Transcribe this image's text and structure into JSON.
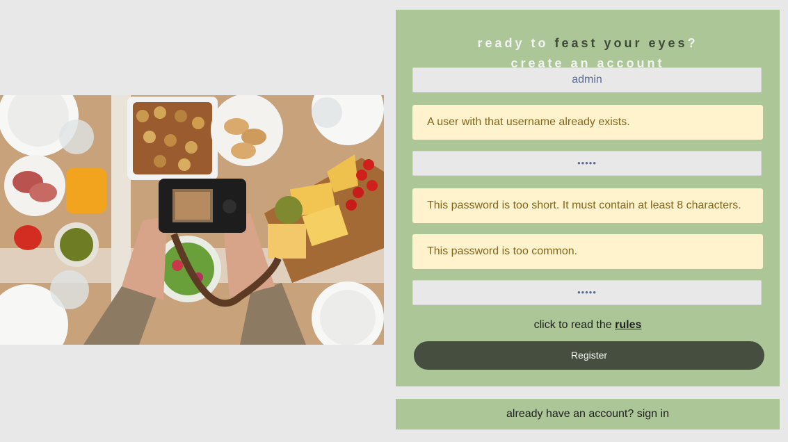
{
  "form": {
    "title_line1_a": "ready to",
    "title_line1_b": "feast your eyes",
    "title_line1_c": "?",
    "title_line2": "create an account",
    "username_value": "admin",
    "username_error": "A user with that username already exists.",
    "password_value": "•••••",
    "password_error_1": "This password is too short. It must contain at least 8 characters.",
    "password_error_2": "This password is too common.",
    "confirm_value": "•••••",
    "rules_prefix": "click to read the",
    "rules_link": "rules",
    "register_label": "Register"
  },
  "footer": {
    "signin_text": "already have an account? sign in"
  },
  "colors": {
    "background": "#e8e8e8",
    "card": "#adc698",
    "button": "#464f3f",
    "alert_bg": "#fff3cd",
    "alert_text": "#85651a"
  },
  "hero": {
    "icon": "food-photography-image"
  }
}
